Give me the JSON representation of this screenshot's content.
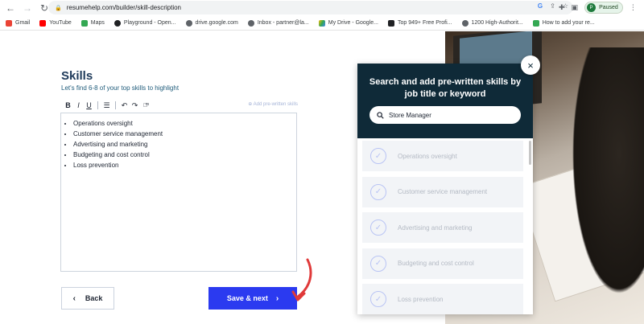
{
  "browser": {
    "url": "resumehelp.com/builder/skill-description",
    "profile_status": "Paused",
    "profile_initial": "P"
  },
  "bookmarks": [
    {
      "label": "Gmail",
      "color": "#ea4335"
    },
    {
      "label": "YouTube",
      "color": "#ff0000"
    },
    {
      "label": "Maps",
      "color": "#34a853"
    },
    {
      "label": "Playground - Open...",
      "color": "#202124"
    },
    {
      "label": "drive.google.com",
      "color": "#5f6368"
    },
    {
      "label": "Inbox - partner@la...",
      "color": "#5f6368"
    },
    {
      "label": "My Drive - Google...",
      "color": "#fbbc04"
    },
    {
      "label": "Top 949+ Free Profi...",
      "color": "#202124"
    },
    {
      "label": "1200 High-Authorit...",
      "color": "#5f6368"
    },
    {
      "label": "How to add your re...",
      "color": "#34a853"
    }
  ],
  "editor_section": {
    "title": "Skills",
    "subtitle": "Let's find 6-8 of your top skills to highlight",
    "prewritten_link": "⊕ Add pre-written skills",
    "skills": [
      "Operations oversight",
      "Customer service management",
      "Advertising and marketing",
      "Budgeting and cost control",
      "Loss prevention"
    ]
  },
  "buttons": {
    "back": "Back",
    "save_next": "Save & next"
  },
  "modal": {
    "title": "Search and add pre-written skills by job title or keyword",
    "search_value": "Store Manager",
    "suggestions": [
      "Operations oversight",
      "Customer service management",
      "Advertising and marketing",
      "Budgeting and cost control",
      "Loss prevention"
    ]
  },
  "colors": {
    "primary_button": "#2b3af0",
    "modal_header": "#0f2a38",
    "annotation_arrow": "#e03a3a"
  }
}
